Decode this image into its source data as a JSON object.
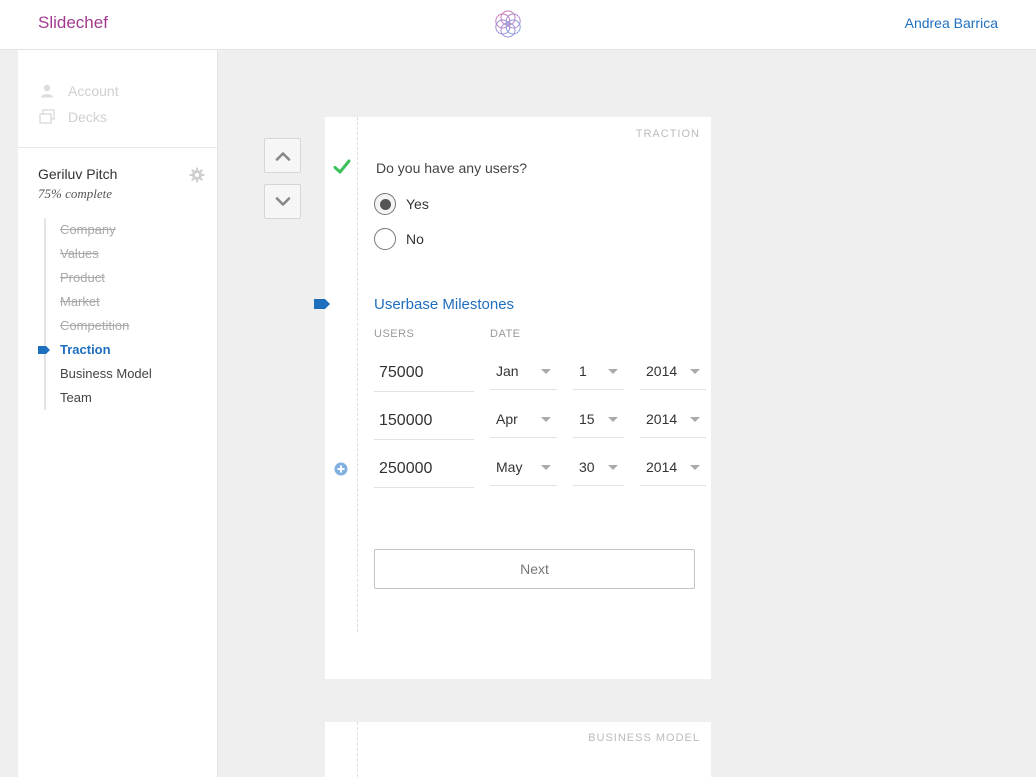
{
  "header": {
    "brand": "Slidechef",
    "logo_icon": "flower-of-life-logo",
    "user_name": "Andrea Barrica"
  },
  "sidebar": {
    "nav": [
      {
        "label": "Account",
        "icon": "user-icon"
      },
      {
        "label": "Decks",
        "icon": "decks-icon"
      }
    ],
    "deck": {
      "title": "Geriluv Pitch",
      "progress": "75% complete"
    },
    "sections": [
      {
        "label": "Company",
        "state": "done"
      },
      {
        "label": "Values",
        "state": "done"
      },
      {
        "label": "Product",
        "state": "done"
      },
      {
        "label": "Market",
        "state": "done"
      },
      {
        "label": "Competition",
        "state": "done"
      },
      {
        "label": "Traction",
        "state": "active"
      },
      {
        "label": "Business Model",
        "state": "todo"
      },
      {
        "label": "Team",
        "state": "todo"
      }
    ]
  },
  "card": {
    "tag": "TRACTION",
    "question": "Do you have any users?",
    "options": [
      {
        "label": "Yes",
        "selected": true
      },
      {
        "label": "No",
        "selected": false
      }
    ],
    "milestones_title": "Userbase Milestones",
    "col_users": "USERS",
    "col_date": "DATE",
    "rows": [
      {
        "users": "75000",
        "month": "Jan",
        "day": "1",
        "year": "2014"
      },
      {
        "users": "150000",
        "month": "Apr",
        "day": "15",
        "year": "2014"
      },
      {
        "users": "250000",
        "month": "May",
        "day": "30",
        "year": "2014"
      }
    ],
    "next_label": "Next"
  },
  "card2": {
    "tag": "BUSINESS MODEL"
  },
  "colors": {
    "brand": "#a23b8f",
    "accent": "#1f6fbf",
    "check": "#3cc05a"
  }
}
